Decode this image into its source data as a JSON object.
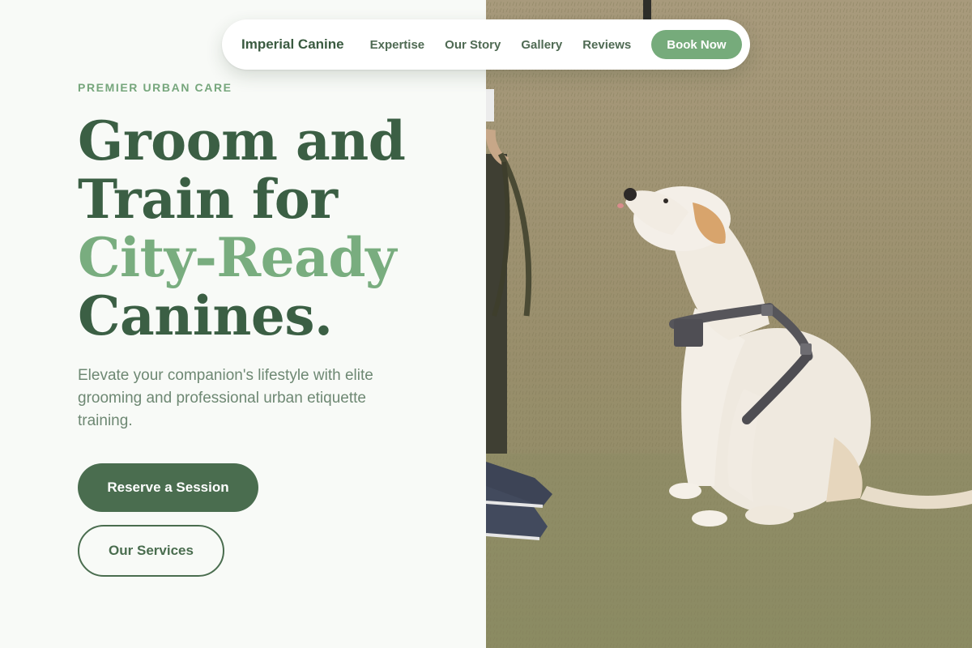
{
  "nav": {
    "brand": "Imperial Canine",
    "links": [
      "Expertise",
      "Our Story",
      "Gallery",
      "Reviews"
    ],
    "cta": "Book Now"
  },
  "hero": {
    "eyebrow": "PREMIER URBAN CARE",
    "headline": {
      "line1": "Groom and",
      "line2": "Train for",
      "line3": "City-Ready",
      "line4": "Canines."
    },
    "subtext": "Elevate your companion's lifestyle with elite grooming and professional urban etiquette training.",
    "primary_button": "Reserve a Session",
    "secondary_button": "Our Services"
  },
  "colors": {
    "brand_dark": "#3b5f44",
    "brand_accent": "#79ad7f",
    "button_dark": "#4a6d4f",
    "background": "#f8faf7"
  },
  "image": {
    "subject": "labrador-sitting-on-grass-photo"
  }
}
